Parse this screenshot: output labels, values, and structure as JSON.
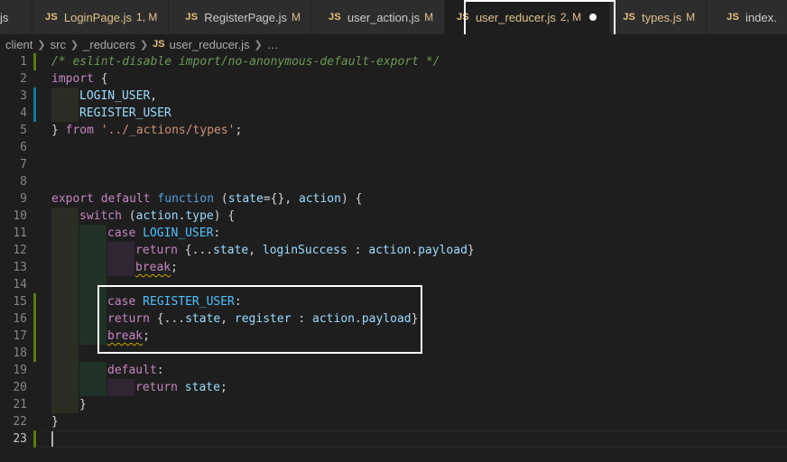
{
  "tabs": [
    {
      "label": "js",
      "status": ""
    },
    {
      "label": "LoginPage.js",
      "status": "1, M"
    },
    {
      "label": "RegisterPage.js",
      "status": "M"
    },
    {
      "label": "user_action.js",
      "status": "M"
    },
    {
      "label": "user_reducer.js",
      "status": "2, M"
    },
    {
      "label": "types.js",
      "status": "M"
    },
    {
      "label": "index.",
      "status": ""
    }
  ],
  "file_badge": "JS",
  "breadcrumb": [
    "client",
    "src",
    "_reducers",
    "user_reducer.js",
    "…"
  ],
  "lines": {
    "l1_comment": "/* eslint-disable import/no-anonymous-default-export */",
    "l2_import": "import",
    "l2_brace": " {",
    "l3_ident": "LOGIN_USER",
    "l3_comma": ",",
    "l4_ident": "REGISTER_USER",
    "l5_close": "} ",
    "l5_from": "from",
    "l5_str": "'../_actions/types'",
    "l5_semi": ";",
    "l9_export": "export",
    "l9_default": "default",
    "l9_function": "function",
    "l9_open": " (",
    "l9_state": "state",
    "l9_eq": "={}, ",
    "l9_action": "action",
    "l9_close": ") {",
    "l10_switch": "switch",
    "l10_open": " (",
    "l10_action": "action",
    "l10_dot": ".",
    "l10_type": "type",
    "l10_close": ") {",
    "l11_case": "case",
    "l11_const": "LOGIN_USER",
    "l11_colon": ":",
    "l12_return": "return",
    "l12_spread": " {...",
    "l12_state": "state",
    "l12_comma": ", ",
    "l12_key": "loginSuccess",
    "l12_colon": " : ",
    "l12_action": "action",
    "l12_dot": ".",
    "l12_payload": "payload",
    "l12_close": "}",
    "l13_break": "break",
    "l13_semi": ";",
    "l15_case": "case",
    "l15_const": "REGISTER_USER",
    "l15_colon": ":",
    "l16_return": "return",
    "l16_spread": " {...",
    "l16_state": "state",
    "l16_comma": ", ",
    "l16_key": "register",
    "l16_colon": " : ",
    "l16_action": "action",
    "l16_dot": ".",
    "l16_payload": "payload",
    "l16_close": "}",
    "l17_break": "break",
    "l17_semi": ";",
    "l19_default": "default",
    "l19_colon": ":",
    "l20_return": "return",
    "l20_state": "state",
    "l20_semi": ";",
    "l21_close": "}",
    "l22_close": "}"
  },
  "line_numbers": [
    "1",
    "2",
    "3",
    "4",
    "5",
    "6",
    "7",
    "8",
    "9",
    "10",
    "11",
    "12",
    "13",
    "14",
    "15",
    "16",
    "17",
    "18",
    "19",
    "20",
    "21",
    "22",
    "23"
  ],
  "colors": {
    "accent_git_added": "#587c0c",
    "accent_git_modified": "#0c7d9d",
    "highlight_box": "#ffffff"
  }
}
